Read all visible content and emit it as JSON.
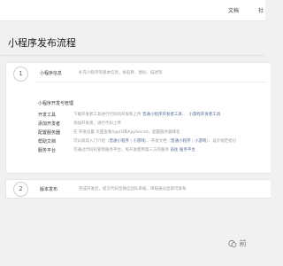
{
  "nav": {
    "docs": "文档",
    "community": "社"
  },
  "page": {
    "title": "小程序发布流程"
  },
  "step1": {
    "number": "1",
    "title": "小程序信息",
    "desc": "补充小程序的基本信息，如名称、图标、描述等",
    "dev_section_title": "小程序开发与管理",
    "rows": [
      {
        "label": "开发工具",
        "desc_parts": [
          {
            "text": "下载开发者工具进行代码的开发和上传 ",
            "link": false
          },
          {
            "text": "普通小程序开发者工具",
            "link": true
          },
          {
            "text": " 、 ",
            "link": false
          },
          {
            "text": "小游戏开发者工具",
            "link": true
          }
        ]
      },
      {
        "label": "添加开发者",
        "desc_parts": [
          {
            "text": "添加开发者，进行代码上传",
            "link": false
          }
        ]
      },
      {
        "label": "配置服务器",
        "desc_parts": [
          {
            "text": "在 开发设置 页面查看AppID和AppSecret，配置服务器域名",
            "link": false
          }
        ]
      },
      {
        "label": "帮助文档",
        "desc_parts": [
          {
            "text": "可以阅读入门介绍（",
            "link": false
          },
          {
            "text": "普通小程序",
            "link": true
          },
          {
            "text": " | ",
            "link": false
          },
          {
            "text": "小游戏",
            "link": true
          },
          {
            "text": "）、开发文档（",
            "link": false
          },
          {
            "text": "普通小程序",
            "link": true
          },
          {
            "text": " | ",
            "link": false
          },
          {
            "text": "小游戏",
            "link": true
          },
          {
            "text": "）、设计规范指引",
            "link": false
          }
        ]
      },
      {
        "label": "服务平台",
        "desc_parts": [
          {
            "text": "可通过代码托管到服务平台，免开发使用第三方的服务 ",
            "link": false
          },
          {
            "text": "前往 服务平台",
            "link": true
          }
        ]
      }
    ]
  },
  "step2": {
    "number": "2",
    "title": "版本发布",
    "desc": "完成开发后，提交代码至微信团队审核，审核通过后即可发布"
  },
  "watermark": {
    "text": "前"
  }
}
